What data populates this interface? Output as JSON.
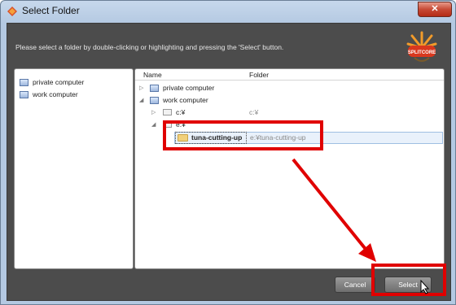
{
  "window": {
    "title": "Select Folder",
    "close_label": "✕"
  },
  "instruction": "Please select a folder by double-clicking or highlighting and pressing the 'Select' button.",
  "logo_text": "SPLITCORE",
  "locations": [
    {
      "label": "private computer",
      "icon": "computer-icon"
    },
    {
      "label": "work computer",
      "icon": "computer-icon"
    }
  ],
  "table": {
    "headers": {
      "name": "Name",
      "folder": "Folder"
    },
    "rows": [
      {
        "name": "private computer",
        "folder": ""
      },
      {
        "name": "work computer",
        "folder": ""
      },
      {
        "name": "c:¥",
        "folder": "c:¥"
      },
      {
        "name": "e:¥",
        "folder": ""
      },
      {
        "name": "tuna-cutting-up",
        "folder": "e:¥tuna-cutting-up"
      }
    ]
  },
  "buttons": {
    "cancel": "Cancel",
    "select": "Select"
  },
  "colors": {
    "annotation_red": "#e00000",
    "dialog_bg": "#4c4c4c"
  }
}
